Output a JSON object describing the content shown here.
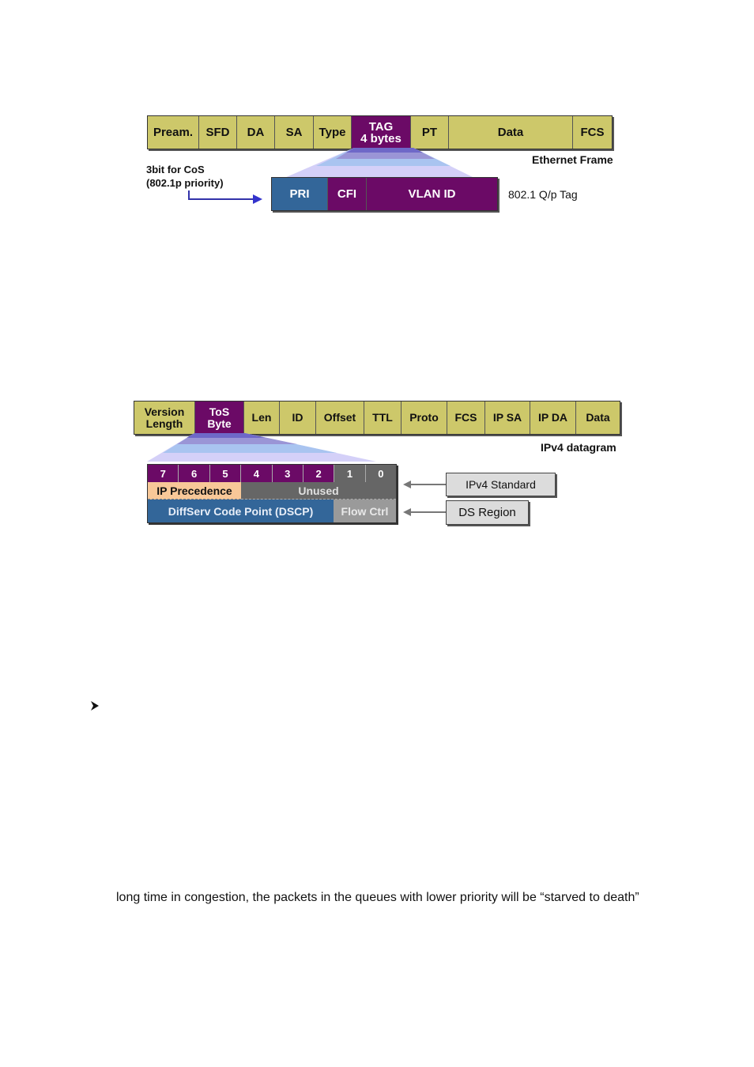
{
  "ethernet_diagram": {
    "fields": [
      {
        "label": "Pream.",
        "style": "olive"
      },
      {
        "label": "SFD",
        "style": "olive"
      },
      {
        "label": "DA",
        "style": "olive"
      },
      {
        "label": "SA",
        "style": "olive"
      },
      {
        "label": "Type",
        "style": "olive"
      },
      {
        "label": "TAG\n4 bytes",
        "style": "purple"
      },
      {
        "label": "PT",
        "style": "olive"
      },
      {
        "label": "Data",
        "style": "olive"
      },
      {
        "label": "FCS",
        "style": "olive"
      }
    ],
    "frame_caption": "Ethernet Frame",
    "cos_note_line1": "3bit for CoS",
    "cos_note_line2": "(802.1p priority)",
    "tag_fields": [
      {
        "label": "PRI",
        "style": "blue"
      },
      {
        "label": "CFI",
        "style": "purple"
      },
      {
        "label": "VLAN ID",
        "style": "purple"
      }
    ],
    "tag_caption": "802.1 Q/p Tag"
  },
  "ipv4_diagram": {
    "fields": [
      {
        "label": "Version\nLength",
        "style": "olive"
      },
      {
        "label": "ToS\nByte",
        "style": "purple"
      },
      {
        "label": "Len",
        "style": "olive"
      },
      {
        "label": "ID",
        "style": "olive"
      },
      {
        "label": "Offset",
        "style": "olive"
      },
      {
        "label": "TTL",
        "style": "olive"
      },
      {
        "label": "Proto",
        "style": "olive"
      },
      {
        "label": "FCS",
        "style": "olive"
      },
      {
        "label": "IP SA",
        "style": "olive"
      },
      {
        "label": "IP DA",
        "style": "olive"
      },
      {
        "label": "Data",
        "style": "olive"
      }
    ],
    "datagram_caption": "IPv4 datagram",
    "bits": [
      "7",
      "6",
      "5",
      "4",
      "3",
      "2",
      "1",
      "0"
    ],
    "ip_precedence_label": "IP Precedence",
    "unused_label": "Unused",
    "dscp_label": "DiffServ Code Point (DSCP)",
    "flow_ctrl_label": "Flow Ctrl",
    "callout_standard": "IPv4 Standard",
    "callout_ds": "DS Region"
  },
  "bullet_icon": "arrowhead-bullet",
  "body_text": "long time in congestion, the packets in the queues with lower priority will be “starved to death”"
}
